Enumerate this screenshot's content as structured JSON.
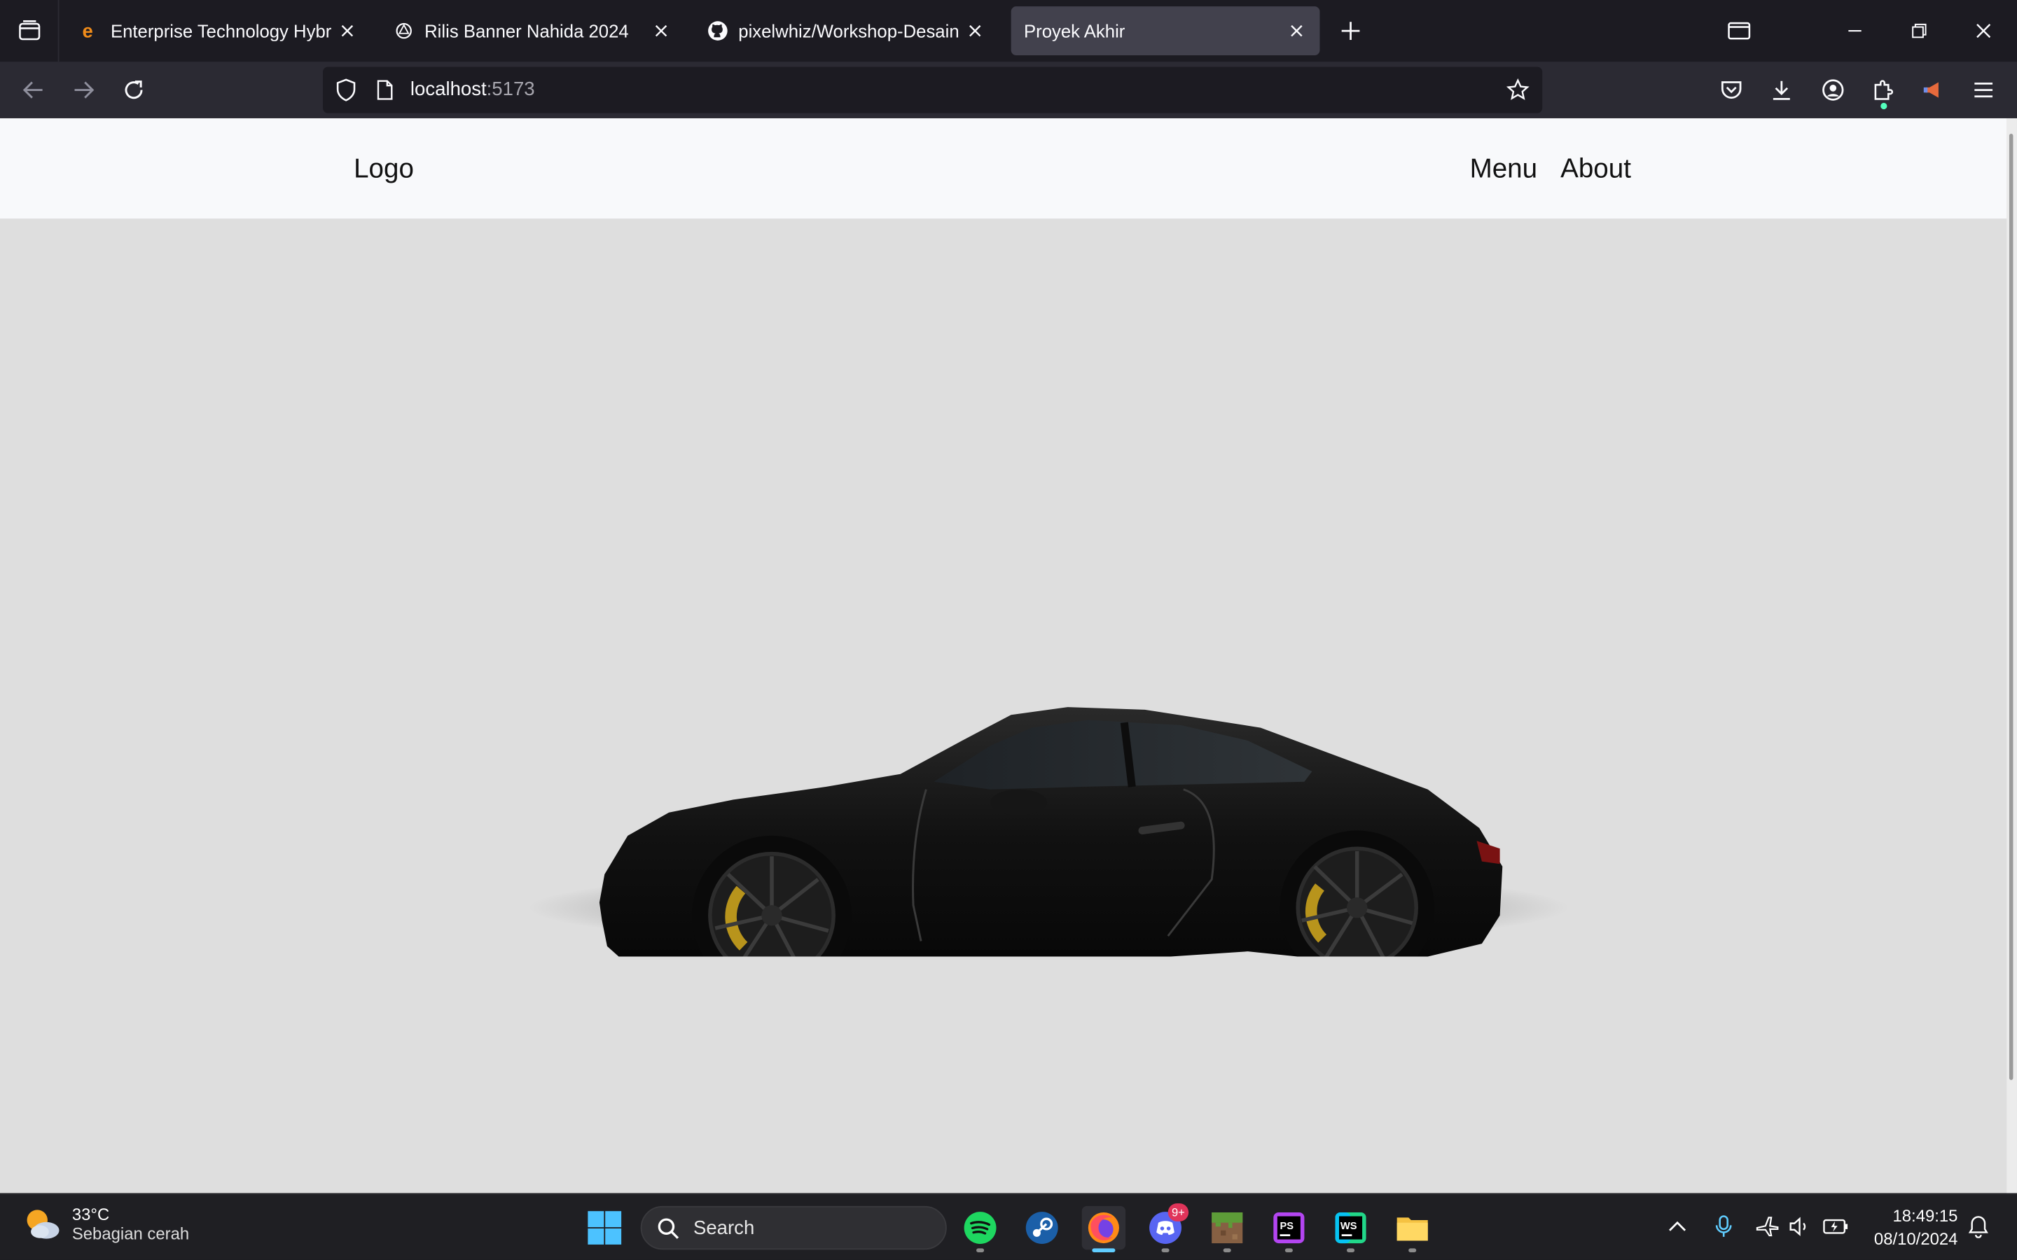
{
  "browser": {
    "tabs": [
      {
        "title": "Enterprise Technology Hybrid C",
        "favicon": "e-brand-icon",
        "active": false
      },
      {
        "title": "Rilis Banner Nahida 2024",
        "favicon": "openai-icon",
        "active": false
      },
      {
        "title": "pixelwhiz/Workshop-Desain-We",
        "favicon": "github-icon",
        "active": false
      },
      {
        "title": "Proyek Akhir",
        "favicon": "",
        "active": true
      }
    ],
    "url_host": "localhost",
    "url_port": ":5173"
  },
  "page": {
    "logo": "Logo",
    "nav": [
      "Menu",
      "About"
    ],
    "background": "#dedede",
    "header_background": "#f8f9fb"
  },
  "taskbar": {
    "weather_temp": "33°C",
    "weather_desc": "Sebagian cerah",
    "search_label": "Search",
    "apps": [
      "spotify-icon",
      "steam-icon",
      "firefox-icon",
      "discord-icon",
      "minecraft-icon",
      "phpstorm-icon",
      "webstorm-icon",
      "file-explorer-icon"
    ],
    "discord_badge": "9+",
    "time": "18:49:15",
    "date": "08/10/2024"
  }
}
